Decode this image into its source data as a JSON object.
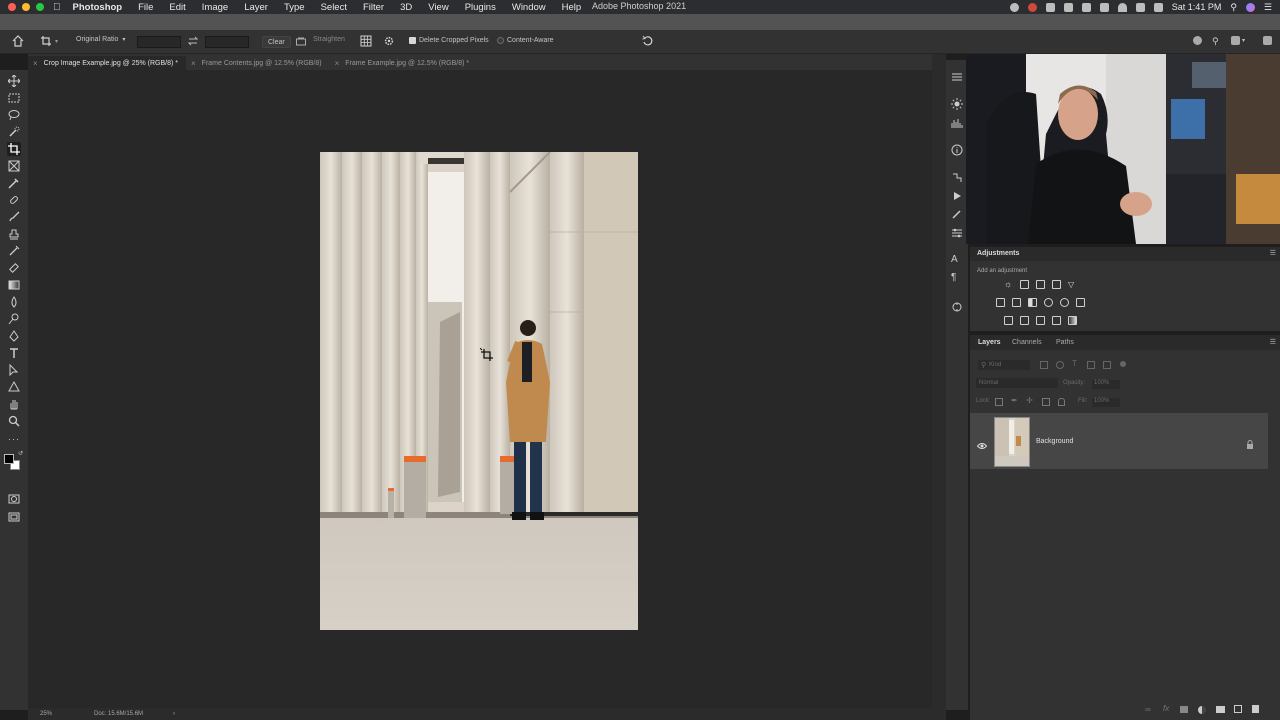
{
  "menubar": {
    "app_name": "Photoshop",
    "items": [
      "File",
      "Edit",
      "Image",
      "Layer",
      "Type",
      "Select",
      "Filter",
      "3D",
      "View",
      "Plugins",
      "Window",
      "Help"
    ],
    "window_title": "Adobe Photoshop 2021",
    "clock": "Sat 1:41 PM"
  },
  "options_bar": {
    "ratio_label": "Original Ratio",
    "clear_label": "Clear",
    "straighten_label": "Straighten",
    "delete_cropped_label": "Delete Cropped Pixels",
    "content_aware_label": "Content-Aware"
  },
  "tabs": [
    {
      "label": "Crop Image Example.jpg @ 25% (RGB/8) *"
    },
    {
      "label": "Frame Contents.jpg @ 12.5% (RGB/8)"
    },
    {
      "label": "Frame Example.jpg @ 12.5% (RGB/8) *"
    }
  ],
  "status": {
    "zoom": "25%",
    "doc": "Doc: 15.6M/15.6M"
  },
  "adjustments": {
    "title": "Adjustments",
    "hint": "Add an adjustment"
  },
  "layers_panel": {
    "tabs": [
      "Layers",
      "Channels",
      "Paths"
    ],
    "kind_placeholder": "Kind",
    "blend_mode": "Normal",
    "opacity_label": "Opacity:",
    "opacity_value": "100%",
    "lock_label": "Lock:",
    "fill_label": "Fill:",
    "fill_value": "100%",
    "layer_name": "Background"
  },
  "colors": {
    "accent_orange": "#e86a2c",
    "panel_bg": "#323232",
    "canvas_bg": "#282828"
  }
}
